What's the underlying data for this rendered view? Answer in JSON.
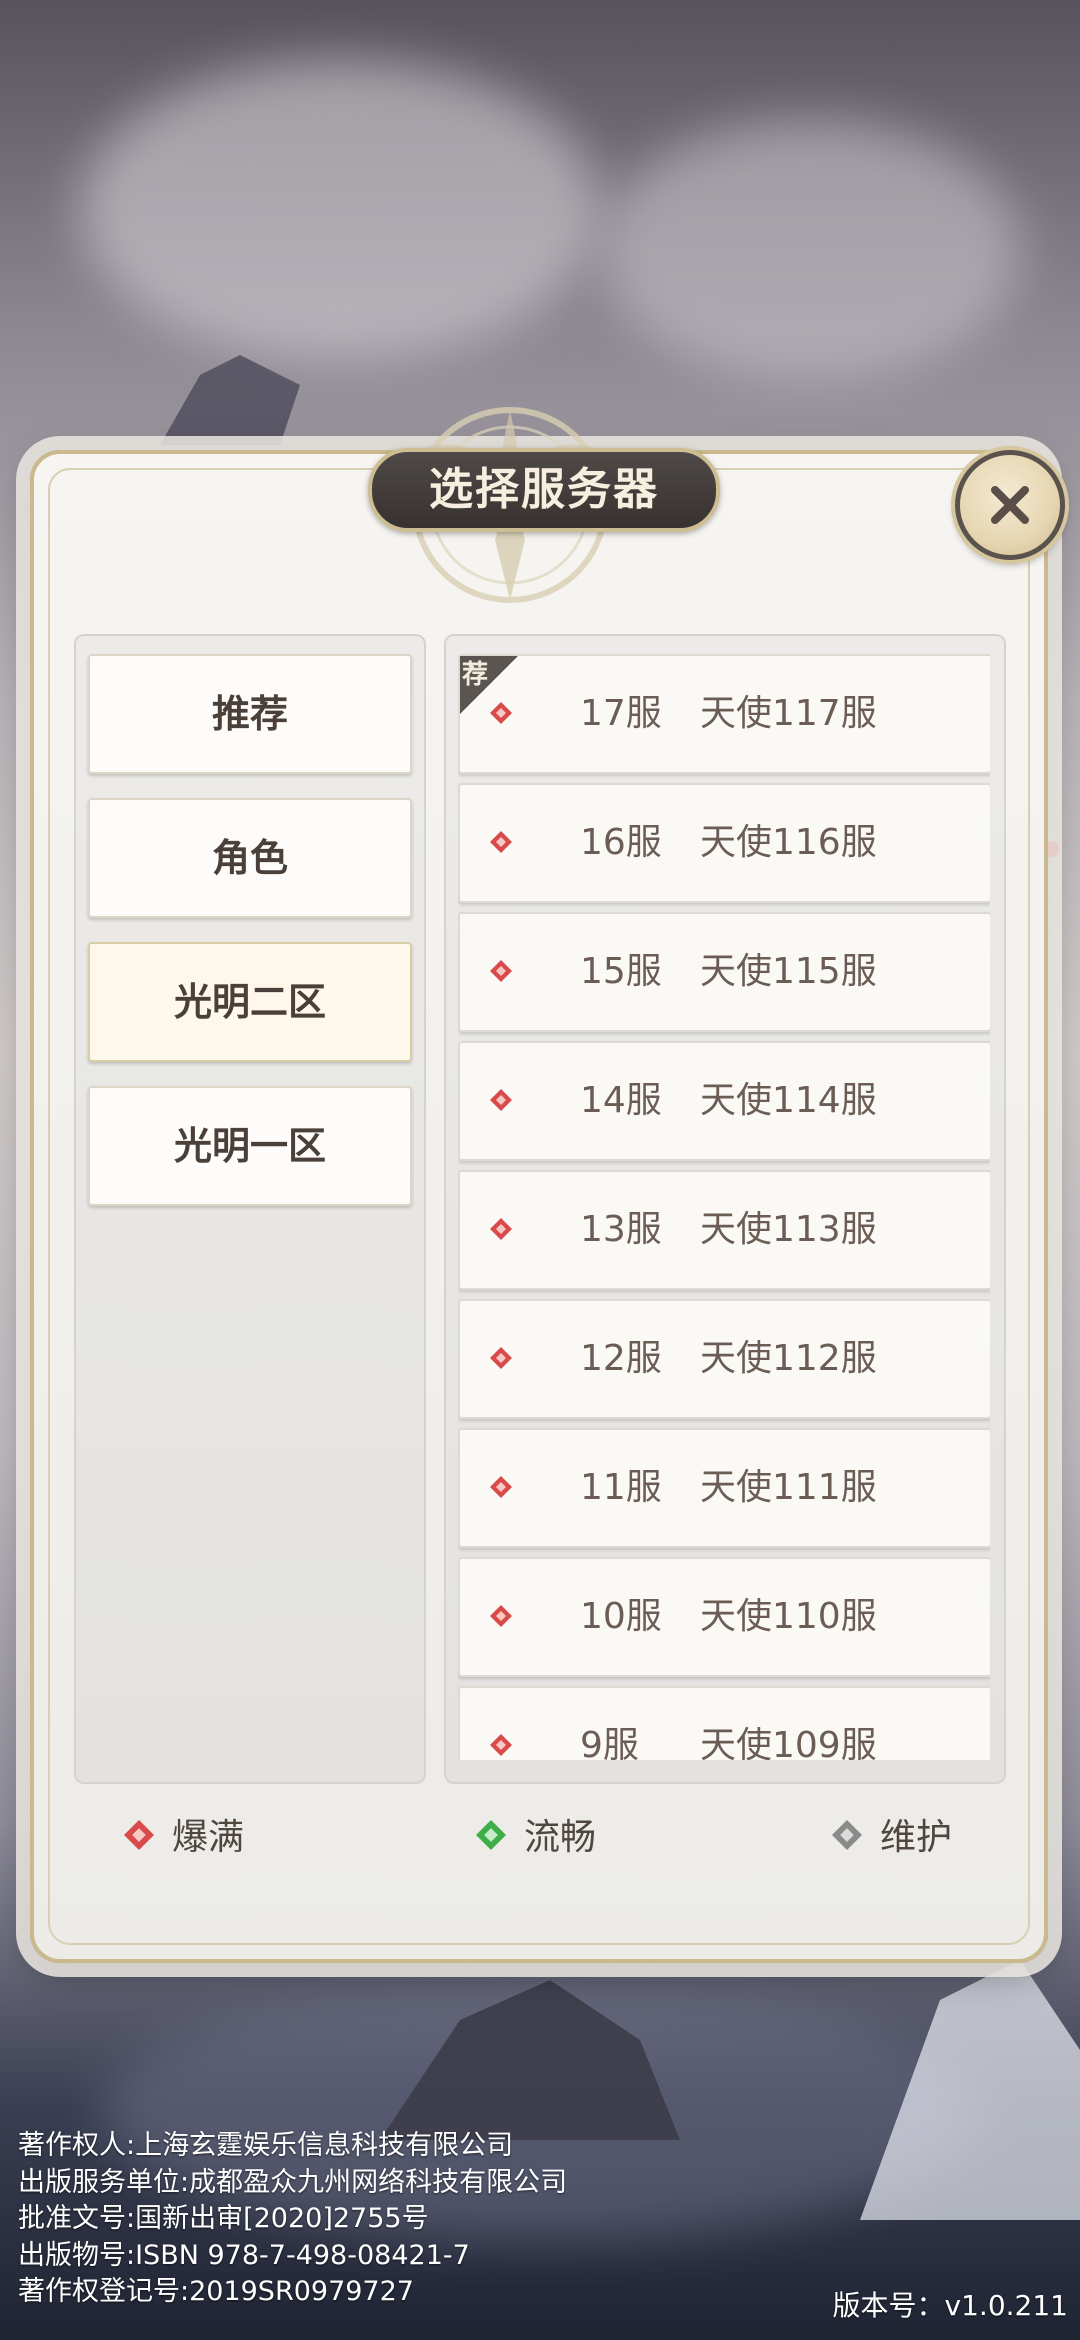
{
  "dialog": {
    "title": "选择服务器"
  },
  "categories": [
    {
      "label": "推荐",
      "active": false
    },
    {
      "label": "角色",
      "active": false
    },
    {
      "label": "光明二区",
      "active": true
    },
    {
      "label": "光明一区",
      "active": false
    }
  ],
  "servers": [
    {
      "num": "17服",
      "name": "天使117服",
      "status": "爆满",
      "recommended": true,
      "tag": "荐"
    },
    {
      "num": "16服",
      "name": "天使116服",
      "status": "爆满",
      "recommended": false
    },
    {
      "num": "15服",
      "name": "天使115服",
      "status": "爆满",
      "recommended": false
    },
    {
      "num": "14服",
      "name": "天使114服",
      "status": "爆满",
      "recommended": false
    },
    {
      "num": "13服",
      "name": "天使113服",
      "status": "爆满",
      "recommended": false
    },
    {
      "num": "12服",
      "name": "天使112服",
      "status": "爆满",
      "recommended": false
    },
    {
      "num": "11服",
      "name": "天使111服",
      "status": "爆满",
      "recommended": false
    },
    {
      "num": "10服",
      "name": "天使110服",
      "status": "爆满",
      "recommended": false
    },
    {
      "num": "9服",
      "name": "天使109服",
      "status": "爆满",
      "recommended": false
    }
  ],
  "legend": [
    {
      "label": "爆满",
      "color": "#d94b4b",
      "icon": "red-diamond-icon"
    },
    {
      "label": "流畅",
      "color": "#3fae4a",
      "icon": "green-diamond-icon"
    },
    {
      "label": "维护",
      "color": "#8a8a8a",
      "icon": "gray-diamond-icon"
    }
  ],
  "footer": {
    "lines": [
      "著作权人:上海玄霆娱乐信息科技有限公司",
      "出版服务单位:成都盈众九州网络科技有限公司",
      "批准文号:国新出审[2020]2755号",
      "出版物号:ISBN 978-7-498-08421-7",
      "著作权登记号:2019SR0979727"
    ],
    "version": "版本号：v1.0.211"
  }
}
